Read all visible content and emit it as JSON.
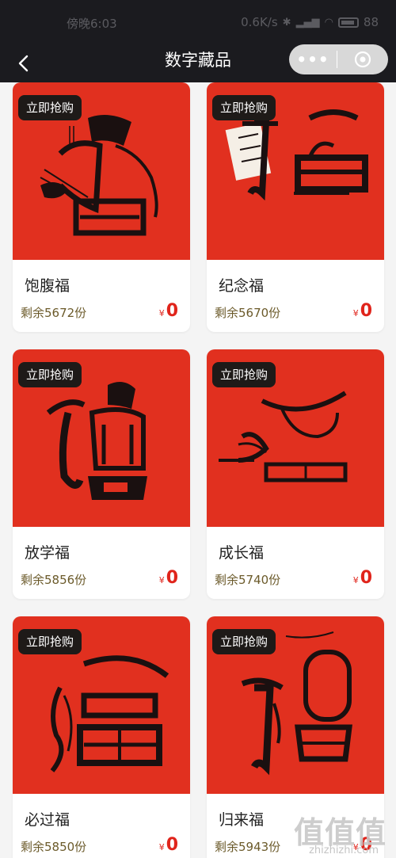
{
  "status_bar": {
    "time": "傍晚6:03",
    "net_speed": "0.6K/s",
    "battery": "88"
  },
  "nav": {
    "title": "数字藏品",
    "more_label": "•••"
  },
  "products": [
    {
      "name": "饱腹福",
      "badge": "立即抢购",
      "remain": "剩余5672份",
      "currency": "¥",
      "price": "0"
    },
    {
      "name": "纪念福",
      "badge": "立即抢购",
      "remain": "剩余5670份",
      "currency": "¥",
      "price": "0"
    },
    {
      "name": "放学福",
      "badge": "立即抢购",
      "remain": "剩余5856份",
      "currency": "¥",
      "price": "0"
    },
    {
      "name": "成长福",
      "badge": "立即抢购",
      "remain": "剩余5740份",
      "currency": "¥",
      "price": "0"
    },
    {
      "name": "必过福",
      "badge": "立即抢购",
      "remain": "剩余5850份",
      "currency": "¥",
      "price": "0"
    },
    {
      "name": "归来福",
      "badge": "立即抢购",
      "remain": "剩余5943份",
      "currency": "¥",
      "price": "0"
    }
  ],
  "watermark": {
    "text": "值值值",
    "url": "zhizhizhi.com"
  },
  "colors": {
    "card_art_background": "#e1301f",
    "price": "#e0241b",
    "nav_background": "#1b1b1f",
    "badge_background": "#1e1a18"
  }
}
